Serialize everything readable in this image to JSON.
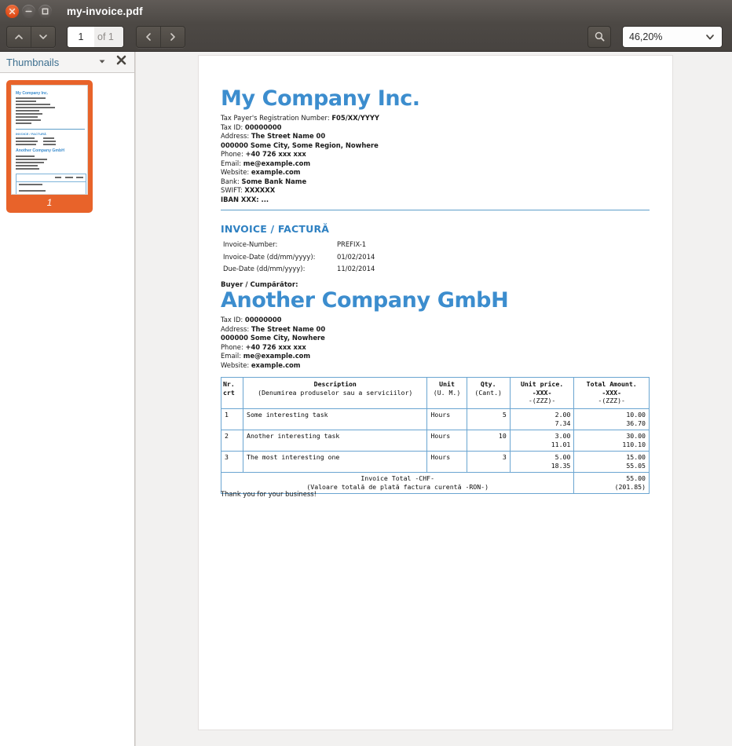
{
  "window": {
    "title": "my-invoice.pdf",
    "controls": {
      "close": "close-button",
      "minimize": "minimize-button",
      "maximize": "maximize-button"
    }
  },
  "toolbar": {
    "page_up_icon": "chevron-up-icon",
    "page_down_icon": "chevron-down-icon",
    "page_number": "1",
    "page_total": "of 1",
    "prev_icon": "chevron-left-icon",
    "next_icon": "chevron-right-icon",
    "search_icon": "search-icon",
    "zoom_level": "46,20%",
    "zoom_dropdown_icon": "chevron-down-icon"
  },
  "sidebar": {
    "title": "Thumbnails",
    "menu_icon": "triangle-down-icon",
    "close_icon": "close-x-icon",
    "thumbnails": [
      {
        "label": "1",
        "selected": true
      }
    ]
  },
  "document": {
    "seller": {
      "name": "My Company Inc.",
      "lines": [
        {
          "label": "Tax Payer's Registration Number: ",
          "value": "F05/XX/YYYY"
        },
        {
          "label": "Tax ID: ",
          "value": "00000000"
        },
        {
          "label": "Address: ",
          "value": "The Street Name 00"
        },
        {
          "label": "",
          "value": "000000 Some City, Some Region, Nowhere"
        },
        {
          "label": "Phone: ",
          "value": "+40 726 xxx xxx"
        },
        {
          "label": "Email: ",
          "value": "me@example.com"
        },
        {
          "label": "Website: ",
          "value": "example.com"
        },
        {
          "label": "Bank: ",
          "value": "Some Bank Name"
        },
        {
          "label": "SWIFT: ",
          "value": "XXXXXX"
        },
        {
          "label": "",
          "value": "IBAN XXX: ..."
        }
      ]
    },
    "invoice_heading": "INVOICE / FACTURĂ",
    "invoice_meta": [
      {
        "key": "Invoice-Number:",
        "value": "PREFIX-1"
      },
      {
        "key": "Invoice-Date (dd/mm/yyyy):",
        "value": "01/02/2014"
      },
      {
        "key": "Due-Date (dd/mm/yyyy):",
        "value": "11/02/2014"
      }
    ],
    "buyer_label": "Buyer / Cumpărător:",
    "buyer": {
      "name": "Another Company GmbH",
      "lines": [
        {
          "label": "Tax ID: ",
          "value": "00000000"
        },
        {
          "label": "Address: ",
          "value": "The Street Name 00"
        },
        {
          "label": "",
          "value": "000000 Some City, Nowhere"
        },
        {
          "label": "Phone: ",
          "value": "+40 726 xxx xxx"
        },
        {
          "label": "Email: ",
          "value": "me@example.com"
        },
        {
          "label": "Website: ",
          "value": "example.com"
        }
      ]
    },
    "table": {
      "headers": {
        "nr": {
          "line1": "Nr.",
          "line2": "crt"
        },
        "description": {
          "line1": "Description",
          "line2": "(Denumirea produselor sau a serviciilor)"
        },
        "unit": {
          "line1": "Unit",
          "line2": "(U. M.)"
        },
        "qty": {
          "line1": "Qty.",
          "line2": "(Cant.)"
        },
        "unit_price": {
          "line1": "Unit price.",
          "line2": "-XXX-",
          "line3": "-(ZZZ)-"
        },
        "total_amount": {
          "line1": "Total Amount.",
          "line2": "-XXX-",
          "line3": "-(ZZZ)-"
        }
      },
      "rows": [
        {
          "nr": "1",
          "description": "Some interesting task",
          "unit": "Hours",
          "qty": "5",
          "price_primary": "2.00",
          "price_secondary": "7.34",
          "total_primary": "10.00",
          "total_secondary": "36.70"
        },
        {
          "nr": "2",
          "description": "Another interesting task",
          "unit": "Hours",
          "qty": "10",
          "price_primary": "3.00",
          "price_secondary": "11.01",
          "total_primary": "30.00",
          "total_secondary": "110.10"
        },
        {
          "nr": "3",
          "description": "The most interesting one",
          "unit": "Hours",
          "qty": "3",
          "price_primary": "5.00",
          "price_secondary": "18.35",
          "total_primary": "15.00",
          "total_secondary": "55.05"
        }
      ],
      "total_row": {
        "label_line1": "Invoice Total -CHF-",
        "label_line2": "(Valoare totală de plată factura curentă -RON-)",
        "value_primary": "55.00",
        "value_secondary": "(201.85)"
      }
    },
    "footer_note": "Thank you for your business!"
  },
  "colors": {
    "accent_blue": "#3c8dce",
    "heading_blue": "#2f81c2",
    "table_border": "#6aa5d1",
    "selection_orange": "#e8632a",
    "chrome_dark": "#4c4845"
  }
}
